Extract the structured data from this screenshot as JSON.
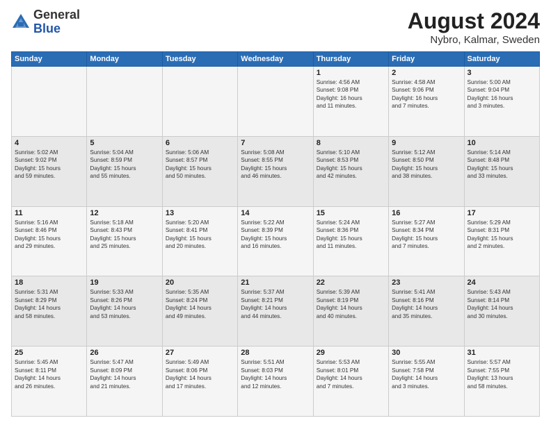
{
  "header": {
    "logo": {
      "general": "General",
      "blue": "Blue"
    },
    "title": "August 2024",
    "subtitle": "Nybro, Kalmar, Sweden"
  },
  "calendar": {
    "headers": [
      "Sunday",
      "Monday",
      "Tuesday",
      "Wednesday",
      "Thursday",
      "Friday",
      "Saturday"
    ],
    "weeks": [
      [
        {
          "day": "",
          "info": ""
        },
        {
          "day": "",
          "info": ""
        },
        {
          "day": "",
          "info": ""
        },
        {
          "day": "",
          "info": ""
        },
        {
          "day": "1",
          "info": "Sunrise: 4:56 AM\nSunset: 9:08 PM\nDaylight: 16 hours\nand 11 minutes."
        },
        {
          "day": "2",
          "info": "Sunrise: 4:58 AM\nSunset: 9:06 PM\nDaylight: 16 hours\nand 7 minutes."
        },
        {
          "day": "3",
          "info": "Sunrise: 5:00 AM\nSunset: 9:04 PM\nDaylight: 16 hours\nand 3 minutes."
        }
      ],
      [
        {
          "day": "4",
          "info": "Sunrise: 5:02 AM\nSunset: 9:02 PM\nDaylight: 15 hours\nand 59 minutes."
        },
        {
          "day": "5",
          "info": "Sunrise: 5:04 AM\nSunset: 8:59 PM\nDaylight: 15 hours\nand 55 minutes."
        },
        {
          "day": "6",
          "info": "Sunrise: 5:06 AM\nSunset: 8:57 PM\nDaylight: 15 hours\nand 50 minutes."
        },
        {
          "day": "7",
          "info": "Sunrise: 5:08 AM\nSunset: 8:55 PM\nDaylight: 15 hours\nand 46 minutes."
        },
        {
          "day": "8",
          "info": "Sunrise: 5:10 AM\nSunset: 8:53 PM\nDaylight: 15 hours\nand 42 minutes."
        },
        {
          "day": "9",
          "info": "Sunrise: 5:12 AM\nSunset: 8:50 PM\nDaylight: 15 hours\nand 38 minutes."
        },
        {
          "day": "10",
          "info": "Sunrise: 5:14 AM\nSunset: 8:48 PM\nDaylight: 15 hours\nand 33 minutes."
        }
      ],
      [
        {
          "day": "11",
          "info": "Sunrise: 5:16 AM\nSunset: 8:46 PM\nDaylight: 15 hours\nand 29 minutes."
        },
        {
          "day": "12",
          "info": "Sunrise: 5:18 AM\nSunset: 8:43 PM\nDaylight: 15 hours\nand 25 minutes."
        },
        {
          "day": "13",
          "info": "Sunrise: 5:20 AM\nSunset: 8:41 PM\nDaylight: 15 hours\nand 20 minutes."
        },
        {
          "day": "14",
          "info": "Sunrise: 5:22 AM\nSunset: 8:39 PM\nDaylight: 15 hours\nand 16 minutes."
        },
        {
          "day": "15",
          "info": "Sunrise: 5:24 AM\nSunset: 8:36 PM\nDaylight: 15 hours\nand 11 minutes."
        },
        {
          "day": "16",
          "info": "Sunrise: 5:27 AM\nSunset: 8:34 PM\nDaylight: 15 hours\nand 7 minutes."
        },
        {
          "day": "17",
          "info": "Sunrise: 5:29 AM\nSunset: 8:31 PM\nDaylight: 15 hours\nand 2 minutes."
        }
      ],
      [
        {
          "day": "18",
          "info": "Sunrise: 5:31 AM\nSunset: 8:29 PM\nDaylight: 14 hours\nand 58 minutes."
        },
        {
          "day": "19",
          "info": "Sunrise: 5:33 AM\nSunset: 8:26 PM\nDaylight: 14 hours\nand 53 minutes."
        },
        {
          "day": "20",
          "info": "Sunrise: 5:35 AM\nSunset: 8:24 PM\nDaylight: 14 hours\nand 49 minutes."
        },
        {
          "day": "21",
          "info": "Sunrise: 5:37 AM\nSunset: 8:21 PM\nDaylight: 14 hours\nand 44 minutes."
        },
        {
          "day": "22",
          "info": "Sunrise: 5:39 AM\nSunset: 8:19 PM\nDaylight: 14 hours\nand 40 minutes."
        },
        {
          "day": "23",
          "info": "Sunrise: 5:41 AM\nSunset: 8:16 PM\nDaylight: 14 hours\nand 35 minutes."
        },
        {
          "day": "24",
          "info": "Sunrise: 5:43 AM\nSunset: 8:14 PM\nDaylight: 14 hours\nand 30 minutes."
        }
      ],
      [
        {
          "day": "25",
          "info": "Sunrise: 5:45 AM\nSunset: 8:11 PM\nDaylight: 14 hours\nand 26 minutes."
        },
        {
          "day": "26",
          "info": "Sunrise: 5:47 AM\nSunset: 8:09 PM\nDaylight: 14 hours\nand 21 minutes."
        },
        {
          "day": "27",
          "info": "Sunrise: 5:49 AM\nSunset: 8:06 PM\nDaylight: 14 hours\nand 17 minutes."
        },
        {
          "day": "28",
          "info": "Sunrise: 5:51 AM\nSunset: 8:03 PM\nDaylight: 14 hours\nand 12 minutes."
        },
        {
          "day": "29",
          "info": "Sunrise: 5:53 AM\nSunset: 8:01 PM\nDaylight: 14 hours\nand 7 minutes."
        },
        {
          "day": "30",
          "info": "Sunrise: 5:55 AM\nSunset: 7:58 PM\nDaylight: 14 hours\nand 3 minutes."
        },
        {
          "day": "31",
          "info": "Sunrise: 5:57 AM\nSunset: 7:55 PM\nDaylight: 13 hours\nand 58 minutes."
        }
      ]
    ]
  }
}
